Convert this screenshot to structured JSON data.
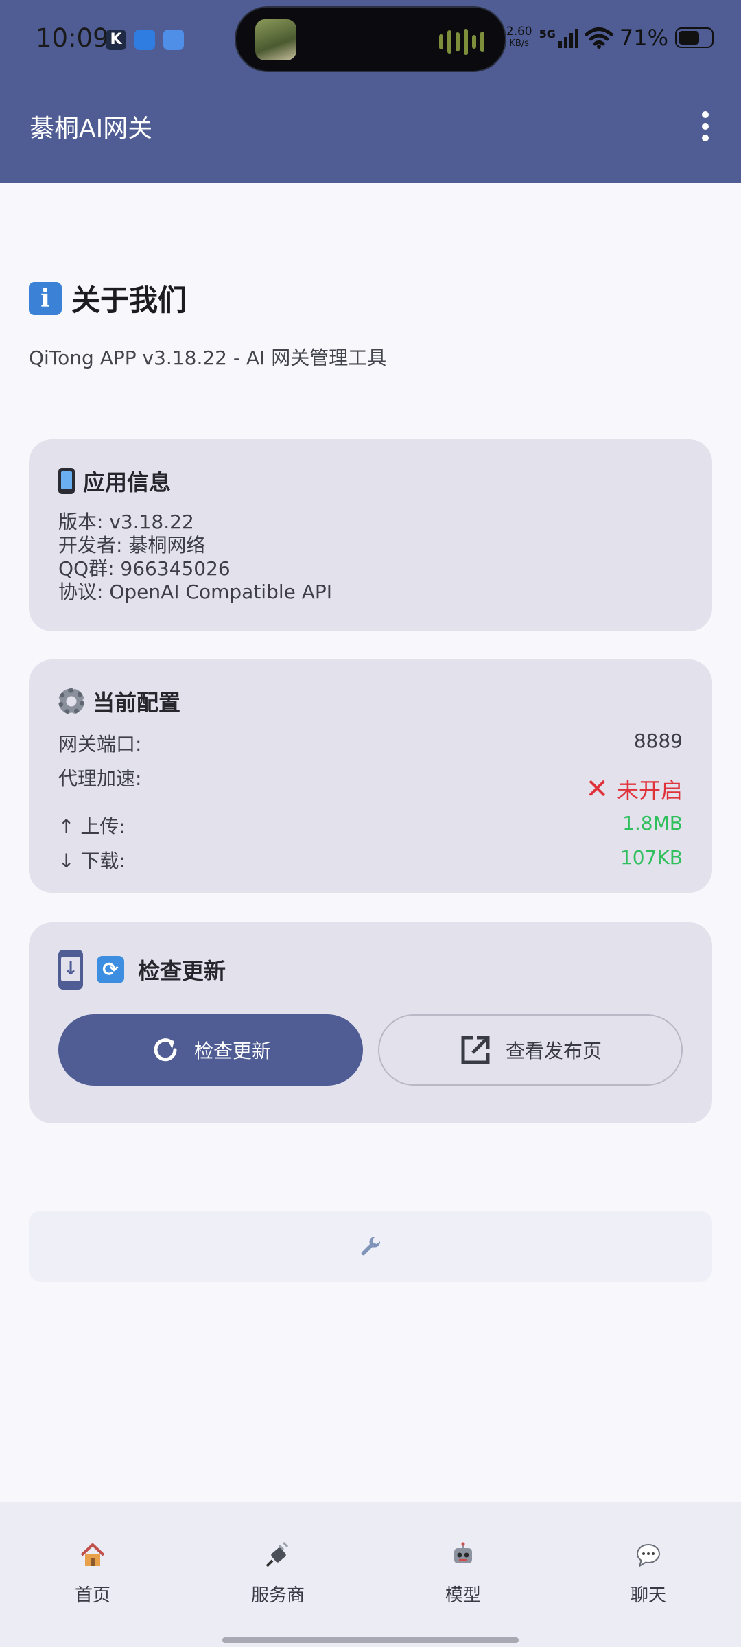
{
  "status_bar": {
    "time": "10:09",
    "net_speed": "2.60",
    "net_speed_unit": "KB/s",
    "network": "5G",
    "battery": "71%",
    "notif_k": "K"
  },
  "app_bar": {
    "title": "綦桐AI网关"
  },
  "about": {
    "heading": "关于我们",
    "subtitle": "QiTong APP v3.18.22 - AI 网关管理工具"
  },
  "app_info": {
    "title": "应用信息",
    "lines": [
      "版本: v3.18.22",
      "开发者: 綦桐网络",
      "QQ群: 966345026",
      "协议: OpenAI Compatible API"
    ]
  },
  "config": {
    "title": "当前配置",
    "port_label": "网关端口:",
    "port_value": "8889",
    "proxy_label": "代理加速:",
    "proxy_value": "未开启",
    "upload_label": "↑  上传:",
    "upload_value": "1.8MB",
    "download_label": "↓  下载:",
    "download_value": "107KB",
    "colors": {
      "off": "#e0323a",
      "traffic": "#2fbf5c"
    }
  },
  "update": {
    "title": "检查更新",
    "check_button": "检查更新",
    "release_button": "查看发布页"
  },
  "bottom_nav": [
    {
      "label": "首页",
      "icon": "house-icon"
    },
    {
      "label": "服务商",
      "icon": "plug-icon"
    },
    {
      "label": "模型",
      "icon": "robot-icon"
    },
    {
      "label": "聊天",
      "icon": "speech-bubble-icon"
    }
  ],
  "theme": {
    "primary": "#4f5d94",
    "card": "#e3e2ec",
    "background": "#f7f7fc"
  }
}
